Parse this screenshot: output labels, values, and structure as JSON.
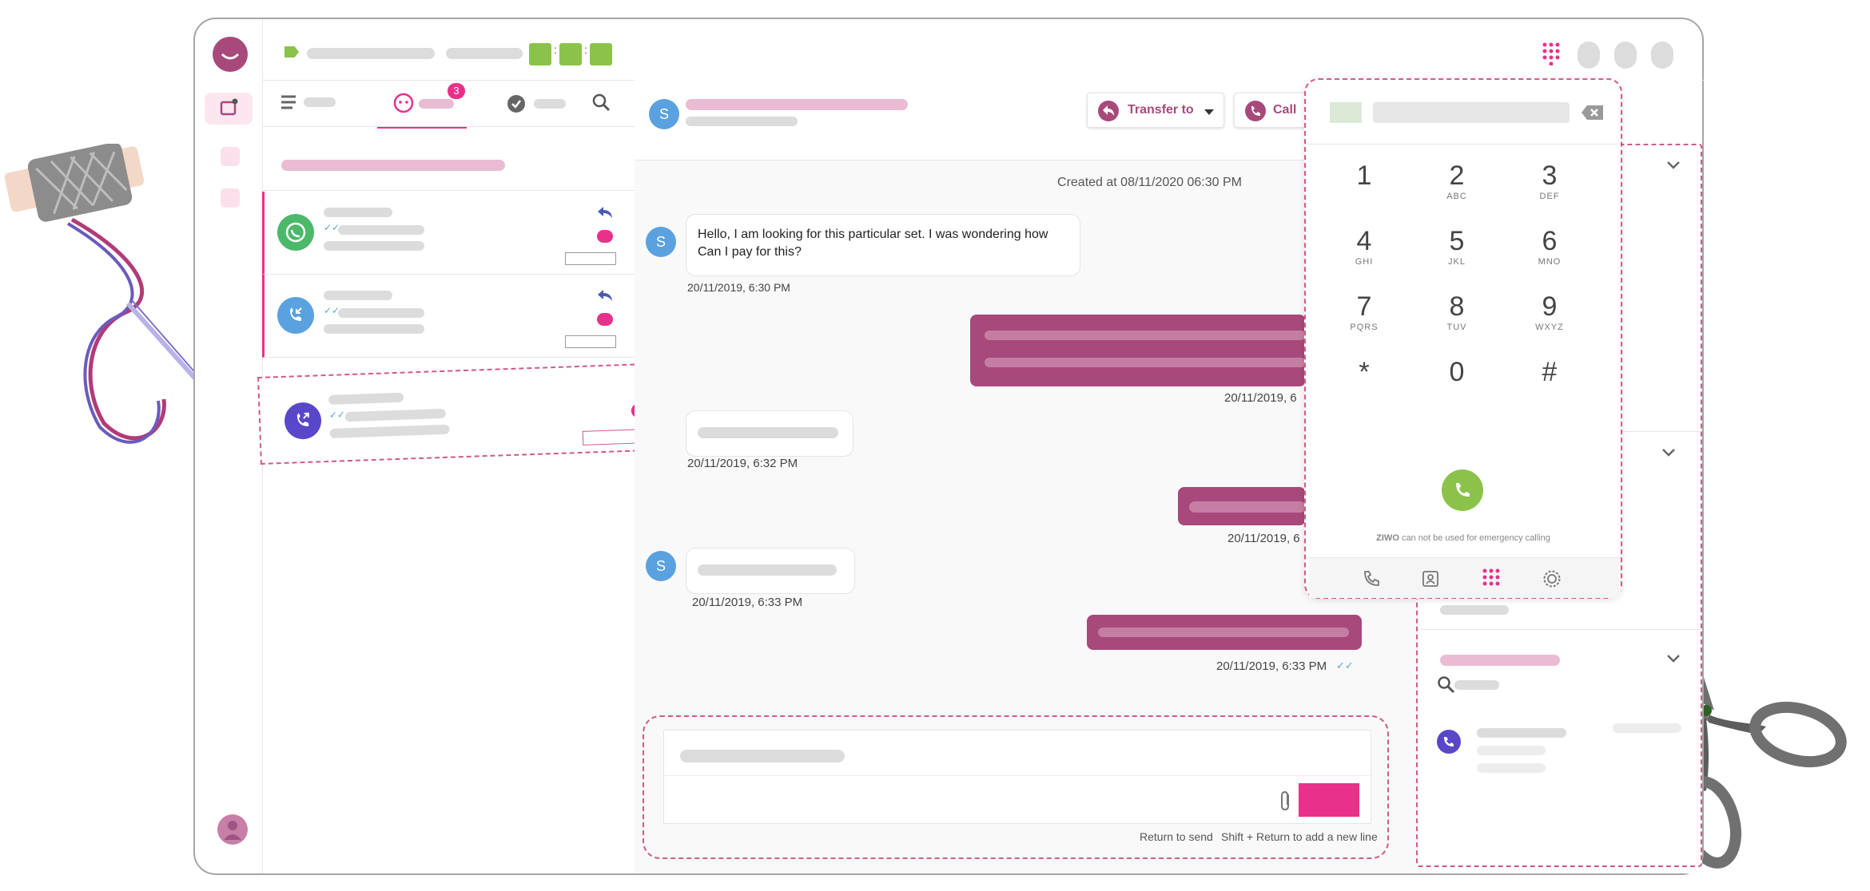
{
  "brand": {
    "accent": "#e8318a",
    "plum": "#a8497b",
    "green": "#8bc34a",
    "blue": "#5aa2df"
  },
  "inbox": {
    "tab_badge": "3"
  },
  "conversation": {
    "avatar_initial": "S",
    "transfer_label": "Transfer to",
    "call_label": "Call",
    "created_at": "Created at 08/11/2020 06:30 PM",
    "messages": [
      {
        "direction": "in",
        "text": "Hello, I am looking for this particular set. I was wondering how Can I pay for this?",
        "timestamp": "20/11/2019, 6:30 PM"
      },
      {
        "direction": "out",
        "text": "",
        "timestamp": "20/11/2019, 6"
      },
      {
        "direction": "in",
        "text": "",
        "timestamp": "20/11/2019, 6:32 PM"
      },
      {
        "direction": "out",
        "text": "",
        "timestamp": "20/11/2019, 6"
      },
      {
        "direction": "in",
        "text": "",
        "timestamp": "20/11/2019, 6:33 PM"
      },
      {
        "direction": "out",
        "text": "",
        "timestamp": "20/11/2019, 6:33 PM"
      }
    ],
    "composer": {
      "hint_send": "Return to send",
      "hint_newline": "Shift + Return to add a new line"
    }
  },
  "dialpad": {
    "keys": [
      {
        "digit": "1",
        "letters": ""
      },
      {
        "digit": "2",
        "letters": "ABC"
      },
      {
        "digit": "3",
        "letters": "DEF"
      },
      {
        "digit": "4",
        "letters": "GHI"
      },
      {
        "digit": "5",
        "letters": "JKL"
      },
      {
        "digit": "6",
        "letters": "MNO"
      },
      {
        "digit": "7",
        "letters": "PQRS"
      },
      {
        "digit": "8",
        "letters": "TUV"
      },
      {
        "digit": "9",
        "letters": "WXYZ"
      },
      {
        "digit": "*",
        "letters": ""
      },
      {
        "digit": "0",
        "letters": ""
      },
      {
        "digit": "#",
        "letters": ""
      }
    ],
    "brand_word": "ZIWO",
    "emergency_note": "can not be used for emergency calling",
    "tabs": [
      "phone-icon",
      "contacts-icon",
      "dialpad-icon",
      "settings-icon"
    ]
  }
}
